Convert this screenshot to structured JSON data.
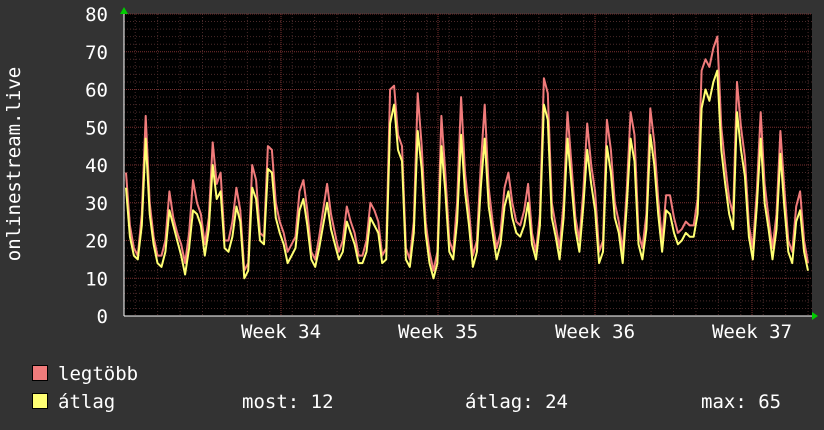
{
  "chart_data": {
    "type": "line",
    "ylabel": "onlinestream.live",
    "ylim": [
      0,
      80
    ],
    "yticks": [
      0,
      10,
      20,
      30,
      40,
      50,
      60,
      70,
      80
    ],
    "x_tick_labels": [
      "Week 34",
      "Week 35",
      "Week 36",
      "Week 37"
    ],
    "grid": true,
    "legend_position": "bottom-left",
    "colors": {
      "background": "#333333",
      "plot_bg": "#000000",
      "grid": "#5a2a2a",
      "text": "#ffffff",
      "arrow": "#00cc00"
    },
    "series": [
      {
        "name": "legtöbb",
        "color": "#f07b7b",
        "values": [
          38,
          24,
          18,
          16,
          27,
          53,
          30,
          21,
          16,
          16,
          20,
          33,
          26,
          22,
          19,
          14,
          22,
          36,
          30,
          27,
          19,
          26,
          46,
          35,
          38,
          20,
          20,
          25,
          34,
          28,
          12,
          14,
          40,
          36,
          22,
          21,
          45,
          44,
          30,
          25,
          22,
          17,
          19,
          21,
          33,
          36,
          28,
          17,
          15,
          21,
          28,
          35,
          27,
          22,
          17,
          20,
          29,
          25,
          22,
          16,
          16,
          20,
          30,
          28,
          25,
          16,
          18,
          60,
          61,
          48,
          45,
          18,
          15,
          25,
          59,
          45,
          25,
          17,
          12,
          17,
          53,
          38,
          20,
          17,
          30,
          58,
          38,
          28,
          16,
          20,
          40,
          56,
          34,
          25,
          18,
          22,
          34,
          38,
          30,
          25,
          24,
          28,
          35,
          22,
          17,
          27,
          63,
          59,
          30,
          24,
          18,
          30,
          54,
          40,
          26,
          20,
          33,
          51,
          40,
          33,
          17,
          20,
          52,
          44,
          30,
          25,
          17,
          33,
          54,
          48,
          22,
          18,
          27,
          55,
          46,
          31,
          20,
          32,
          32,
          26,
          22,
          23,
          25,
          24,
          24,
          31,
          65,
          68,
          66,
          71,
          74,
          50,
          40,
          31,
          27,
          62,
          50,
          42,
          24,
          18,
          33,
          54,
          35,
          26,
          18,
          27,
          49,
          34,
          20,
          17,
          29,
          33,
          20,
          14
        ]
      },
      {
        "name": "átlag",
        "color": "#ffff73",
        "values": [
          34,
          21,
          16,
          15,
          24,
          47,
          27,
          19,
          14,
          13,
          17,
          28,
          24,
          20,
          16,
          11,
          18,
          28,
          27,
          24,
          16,
          23,
          40,
          31,
          33,
          18,
          17,
          21,
          29,
          25,
          10,
          12,
          34,
          31,
          20,
          19,
          39,
          38,
          26,
          22,
          19,
          14,
          16,
          18,
          28,
          31,
          24,
          15,
          13,
          18,
          24,
          30,
          23,
          19,
          15,
          17,
          25,
          22,
          19,
          14,
          14,
          17,
          26,
          24,
          22,
          14,
          15,
          51,
          56,
          44,
          41,
          15,
          13,
          22,
          49,
          39,
          22,
          14,
          10,
          14,
          45,
          33,
          17,
          15,
          25,
          48,
          33,
          24,
          13,
          17,
          34,
          47,
          29,
          22,
          15,
          19,
          29,
          33,
          26,
          22,
          21,
          24,
          30,
          19,
          15,
          24,
          56,
          52,
          26,
          21,
          15,
          26,
          47,
          35,
          23,
          17,
          29,
          44,
          35,
          28,
          14,
          17,
          45,
          38,
          26,
          22,
          14,
          29,
          47,
          41,
          19,
          15,
          23,
          48,
          40,
          27,
          17,
          28,
          27,
          22,
          19,
          20,
          22,
          21,
          21,
          27,
          55,
          60,
          57,
          62,
          65,
          44,
          35,
          27,
          23,
          54,
          44,
          37,
          21,
          15,
          29,
          47,
          30,
          23,
          15,
          23,
          43,
          29,
          17,
          14,
          25,
          28,
          17,
          12
        ]
      }
    ],
    "stats": {
      "most": 12,
      "atlag": 24,
      "max": 65
    }
  },
  "legend": [
    {
      "label": "legtöbb",
      "color": "#f07b7b"
    },
    {
      "label": "átlag",
      "color": "#ffff73"
    }
  ],
  "stats_text": {
    "most_label": "most:",
    "most_value": "12",
    "atlag_label": "átlag:",
    "atlag_value": "24",
    "max_label": "max:",
    "max_value": "65"
  }
}
